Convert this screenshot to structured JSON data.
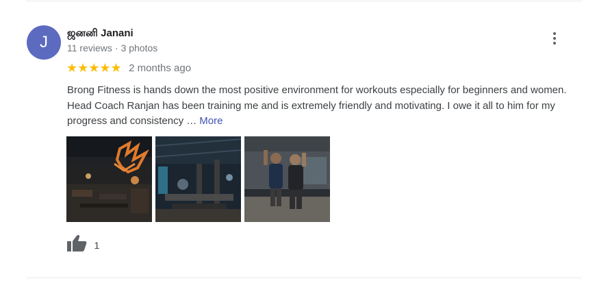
{
  "review": {
    "avatar_initial": "J",
    "avatar_color": "#5c6bc0",
    "reviewer_name": "ஜனனி Janani",
    "review_count": "11 reviews",
    "separator": "·",
    "photo_count": "3 photos",
    "rating": 5,
    "stars": "★★★★★",
    "star_color": "#fbbc04",
    "time": "2 months ago",
    "text": "Brong Fitness is hands down the most positive environment for workouts especially for beginners and women. Head Coach Ranjan has been training me and is extremely friendly and motivating. I owe it all to him for my progress and consistency …",
    "more_label": "More",
    "more_color": "#3f51b5",
    "photos": [
      {
        "icon": "gym-interior-orange-ceiling"
      },
      {
        "icon": "gym-equipment-area"
      },
      {
        "icon": "two-people-posing"
      }
    ],
    "likes": "1",
    "like_icon": "thumbs-up-icon",
    "menu_icon": "more-vert-icon"
  }
}
